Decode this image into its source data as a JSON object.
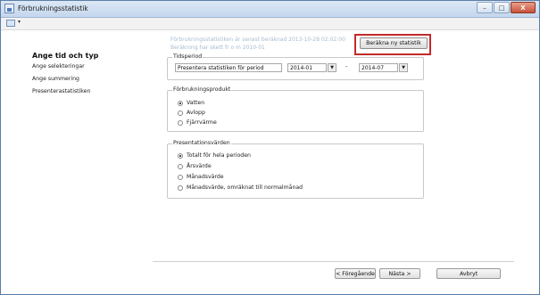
{
  "window": {
    "title": "Förbrukningsstatistik",
    "buttons": {
      "minimize": "–",
      "maximize": "□",
      "close": "X"
    }
  },
  "toolbar": {
    "caret": "▾"
  },
  "left_nav": {
    "title": "Ange tid och typ",
    "items": [
      "Ange selekteringar",
      "Ange summering",
      "Presenterastatistiken"
    ]
  },
  "info": {
    "line1": "Förbrukningsstatistiken är senast beräknad 2013-10-28 02:02:00",
    "line2": "Beräkning har skett fr o m 2010-01"
  },
  "calc_button": "Beräkna ny statistik",
  "tidsperiod": {
    "legend": "Tidsperiod",
    "present_label": "Presentera statistiken för period",
    "from": "2014-01",
    "dash": "-",
    "to": "2014-07",
    "caret": "▼"
  },
  "forbrukningsprodukt": {
    "legend": "Förbrukningsprodukt",
    "options": [
      {
        "label": "Vatten",
        "selected": true
      },
      {
        "label": "Avlopp",
        "selected": false
      },
      {
        "label": "Fjärrvärme",
        "selected": false
      }
    ]
  },
  "presentationsvarden": {
    "legend": "Presentationsvärden",
    "options": [
      {
        "label": "Totalt för hela perioden",
        "selected": true
      },
      {
        "label": "Årsvärde",
        "selected": false
      },
      {
        "label": "Månadsvärde",
        "selected": false
      },
      {
        "label": "Månadsvärde, omräknat till normalmånad",
        "selected": false
      }
    ]
  },
  "footer": {
    "prev": "< Föregående",
    "next": "Nästa >",
    "cancel": "Avbryt"
  },
  "colors": {
    "highlight": "#c32a2a",
    "info_text": "#a7bccf"
  }
}
